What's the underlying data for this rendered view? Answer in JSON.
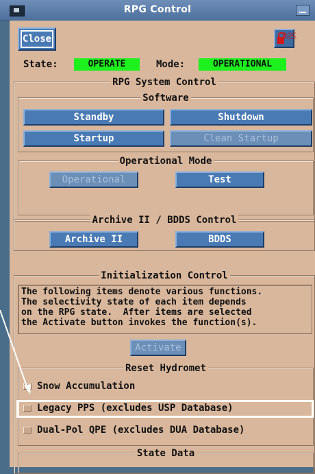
{
  "window": {
    "title": "RPG Control"
  },
  "toolbar": {
    "close_label": "Close",
    "roc_label": "ROC"
  },
  "status": {
    "state_label": "State:",
    "state_value": "OPERATE",
    "mode_label": "Mode:",
    "mode_value": "OPERATIONAL",
    "value_color": "#1df01d"
  },
  "rpg_system_control": {
    "title": "RPG System Control",
    "software": {
      "title": "Software",
      "standby_label": "Standby",
      "shutdown_label": "Shutdown",
      "startup_label": "Startup",
      "clean_startup_label": "Clean Startup"
    },
    "operational_mode": {
      "title": "Operational Mode",
      "operational_label": "Operational",
      "test_label": "Test"
    }
  },
  "archive": {
    "title": "Archive II / BDDS Control",
    "archive_label": "Archive II",
    "bdds_label": "BDDS"
  },
  "init": {
    "title": "Initialization Control",
    "description_lines": [
      "The following items denote various functions.",
      "The selectivity state of each item depends",
      "on the RPG state.  After items are selected",
      "the Activate button invokes the function(s)."
    ],
    "activate_label": "Activate"
  },
  "reset_hydromet": {
    "title": "Reset Hydromet",
    "items": [
      {
        "label": "Snow Accumulation",
        "checked": false
      },
      {
        "label": "Legacy PPS (excludes USP Database)",
        "checked": false
      },
      {
        "label": "Dual-Pol QPE (excludes DUA Database)",
        "checked": false
      }
    ]
  },
  "state_data": {
    "title": "State Data"
  },
  "colors": {
    "panel_bg": "#d9b79c",
    "button_bg": "#4a7ab4",
    "titlebar": "#5a7fae"
  }
}
